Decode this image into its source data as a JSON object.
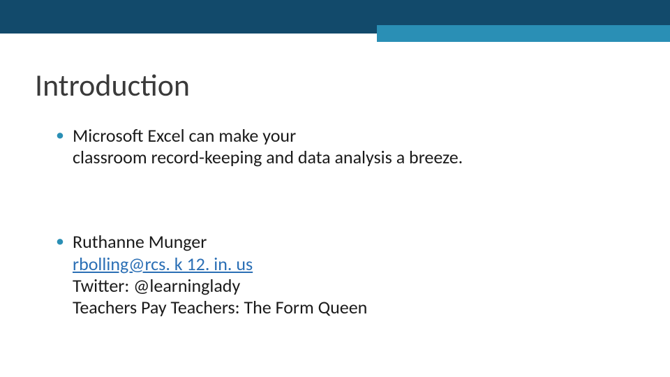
{
  "title": "Introduction",
  "bullets": [
    {
      "line1": "Microsoft Excel can make your",
      "line2": "classroom record-keeping and data analysis a breeze."
    },
    {
      "name": "Ruthanne Munger",
      "email": "rbolling@rcs. k 12. in. us",
      "twitter": "Twitter:  @learninglady",
      "tpt": "Teachers Pay Teachers:  The Form Queen"
    }
  ]
}
